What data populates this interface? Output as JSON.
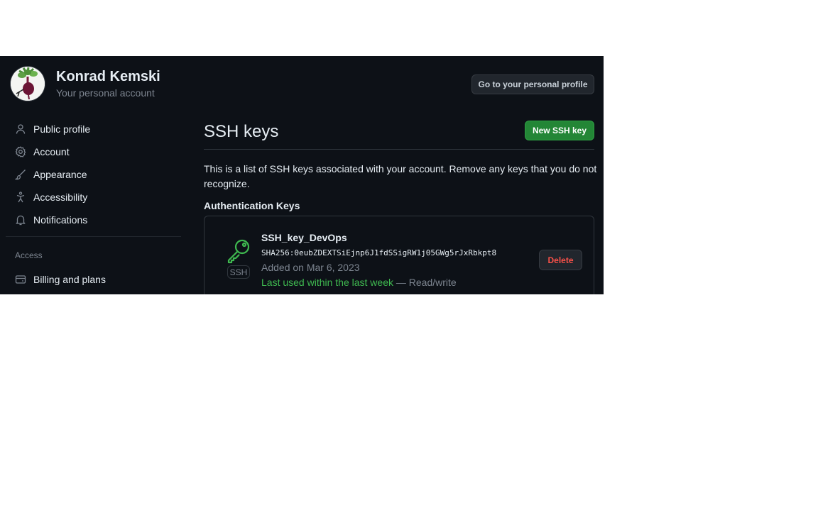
{
  "header": {
    "user_name": "Konrad Kemski",
    "account_type": "Your personal account",
    "profile_button": "Go to your personal profile"
  },
  "sidebar": {
    "items": [
      {
        "label": "Public profile",
        "icon": "person-icon"
      },
      {
        "label": "Account",
        "icon": "gear-icon"
      },
      {
        "label": "Appearance",
        "icon": "paintbrush-icon"
      },
      {
        "label": "Accessibility",
        "icon": "accessibility-icon"
      },
      {
        "label": "Notifications",
        "icon": "bell-icon"
      }
    ],
    "access_heading": "Access",
    "access_items": [
      {
        "label": "Billing and plans",
        "icon": "credit-card-icon"
      }
    ]
  },
  "main": {
    "title": "SSH keys",
    "new_key_button": "New SSH key",
    "intro": "This is a list of SSH keys associated with your account. Remove any keys that you do not recognize.",
    "section_title": "Authentication Keys",
    "keys": [
      {
        "name": "SSH_key_DevOps",
        "fingerprint": "SHA256:0eubZDEXTSiEjnp6J1fdSSigRW1j05GWg5rJxRbkpt8",
        "added": "Added on Mar 6, 2023",
        "last_used": "Last used within the last week",
        "access": " — Read/write",
        "badge": "SSH",
        "delete_label": "Delete"
      }
    ]
  },
  "colors": {
    "background": "#0d1117",
    "primary_button": "#238636",
    "danger": "#f85149",
    "success_text": "#3fb950",
    "muted_text": "#7d8590"
  }
}
